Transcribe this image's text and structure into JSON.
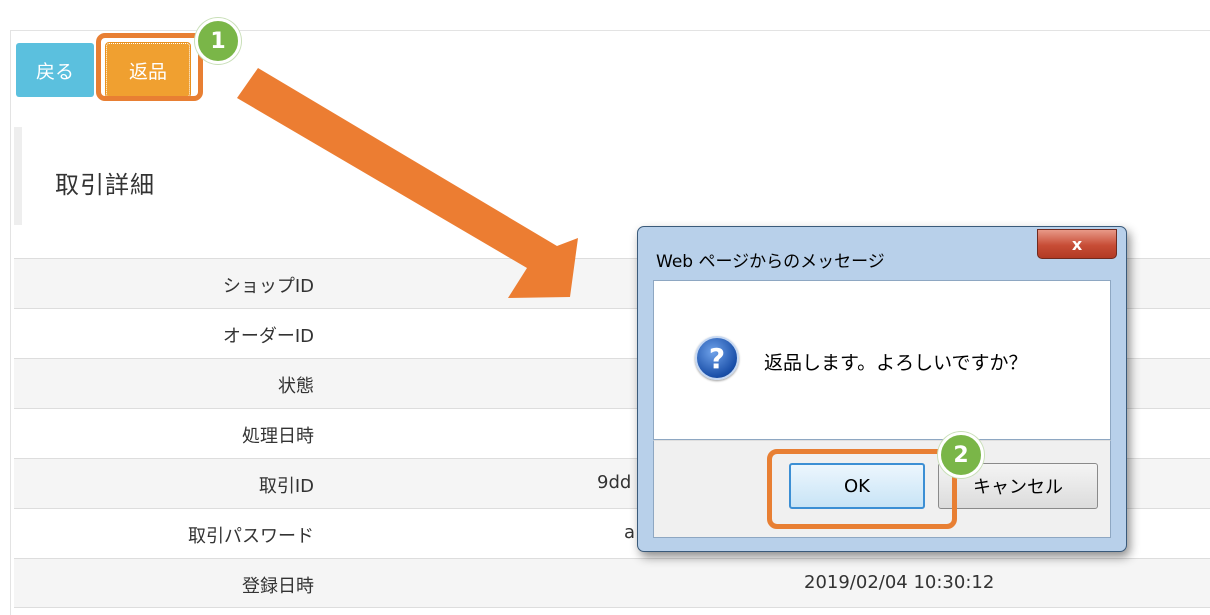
{
  "toolbar": {
    "back_label": "戻る",
    "return_label": "返品"
  },
  "steps": {
    "step1": "1",
    "step2": "2"
  },
  "section": {
    "title": "取引詳細"
  },
  "details": {
    "rows": [
      {
        "label": "ショップID",
        "value": ""
      },
      {
        "label": "オーダーID",
        "value": ""
      },
      {
        "label": "状態",
        "value": ""
      },
      {
        "label": "処理日時",
        "value": ""
      },
      {
        "label": "取引ID",
        "value": "9dd"
      },
      {
        "label": "取引パスワード",
        "value": "a"
      },
      {
        "label": "登録日時",
        "value": "2019/02/04 10:30:12"
      }
    ]
  },
  "dialog": {
    "title": "Web ページからのメッセージ",
    "close_glyph": "x",
    "icon_glyph": "?",
    "message": "返品します。よろしいですか？",
    "ok_label": "OK",
    "cancel_label": "キャンセル"
  },
  "colors": {
    "highlight": "#e87f33",
    "step_badge": "#7ab648",
    "back_button": "#5bc0de",
    "return_button": "#f0a030"
  }
}
